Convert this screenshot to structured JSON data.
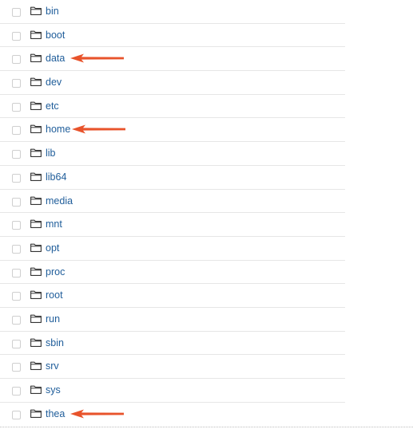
{
  "file_browser": {
    "items": [
      {
        "name": "bin",
        "type": "folder",
        "annotated": false
      },
      {
        "name": "boot",
        "type": "folder",
        "annotated": false
      },
      {
        "name": "data",
        "type": "folder",
        "annotated": true
      },
      {
        "name": "dev",
        "type": "folder",
        "annotated": false
      },
      {
        "name": "etc",
        "type": "folder",
        "annotated": false
      },
      {
        "name": "home",
        "type": "folder",
        "annotated": true
      },
      {
        "name": "lib",
        "type": "folder",
        "annotated": false
      },
      {
        "name": "lib64",
        "type": "folder",
        "annotated": false
      },
      {
        "name": "media",
        "type": "folder",
        "annotated": false
      },
      {
        "name": "mnt",
        "type": "folder",
        "annotated": false
      },
      {
        "name": "opt",
        "type": "folder",
        "annotated": false
      },
      {
        "name": "proc",
        "type": "folder",
        "annotated": false
      },
      {
        "name": "root",
        "type": "folder",
        "annotated": false
      },
      {
        "name": "run",
        "type": "folder",
        "annotated": false
      },
      {
        "name": "sbin",
        "type": "folder",
        "annotated": false
      },
      {
        "name": "srv",
        "type": "folder",
        "annotated": false
      },
      {
        "name": "sys",
        "type": "folder",
        "annotated": false
      },
      {
        "name": "thea",
        "type": "folder",
        "annotated": true
      }
    ]
  },
  "icons": {
    "folder": "folder-icon",
    "checkbox": "checkbox",
    "annotation": "arrow-left-icon"
  },
  "colors": {
    "link": "#1f5d9a",
    "arrow": "#e8532b",
    "row_divider": "#e6e6e6"
  }
}
